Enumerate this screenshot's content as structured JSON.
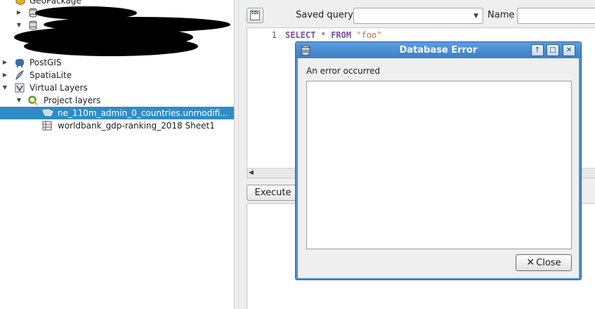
{
  "tree": {
    "items": [
      {
        "label": "GeoPackage"
      },
      {
        "label": "PostGIS"
      },
      {
        "label": "SpatiaLite"
      },
      {
        "label": "Virtual Layers"
      },
      {
        "label": "Project layers"
      },
      {
        "label": "ne_110m_admin_0_countries.unmodifi..."
      },
      {
        "label": "worldbank_gdp-ranking_2018 Sheet1"
      }
    ]
  },
  "sql_panel": {
    "saved_query_label": "Saved query",
    "saved_query_value": "",
    "name_label": "Name",
    "name_value": "",
    "line_number": "1",
    "code": {
      "k1": "SELECT",
      "op": "*",
      "k2": "FROM",
      "str": "\"foo\""
    },
    "execute_label": "Execute"
  },
  "dialog": {
    "title": "Database Error",
    "message": "An error occurred",
    "detail": "",
    "close_label": "Close",
    "title_buttons": {
      "up": "↑",
      "max": "□",
      "close": "✕"
    }
  },
  "colors": {
    "selection": "#308cc6",
    "titlebar": "#3d7fc4",
    "keyword": "#7b4ea3",
    "string": "#c2763b"
  }
}
